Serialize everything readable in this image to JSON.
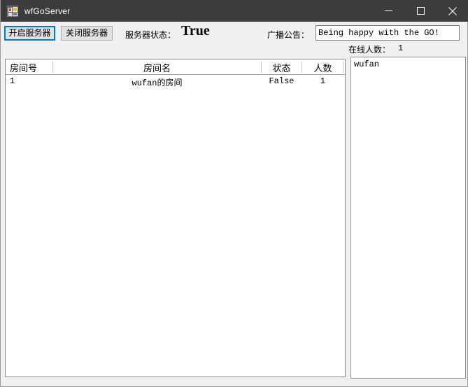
{
  "window": {
    "title": "wfGoServer",
    "icon": "app-icon",
    "controls": {
      "minimize": "minimize-icon",
      "maximize": "maximize-icon",
      "close": "close-icon"
    }
  },
  "toolbar": {
    "start_server_label": "开启服务器",
    "stop_server_label": "关闭服务器",
    "server_status_label": "服务器状态：",
    "server_status_value": "True",
    "broadcast_label": "广播公告：",
    "broadcast_value": "Being happy with the GO!",
    "broadcast_placeholder": "",
    "online_count_label": "在线人数：",
    "online_count_value": "1"
  },
  "rooms_grid": {
    "columns": [
      "房间号",
      "房间名",
      "状态",
      "人数"
    ],
    "rows": [
      {
        "room_id": "1",
        "room_name": "wufan的房间",
        "state": "False",
        "people": "1"
      }
    ]
  },
  "online_list": {
    "items": [
      "wufan"
    ]
  },
  "colors": {
    "titlebar": "#3c3c3c",
    "form_background": "#f0f0f0",
    "accent_focus": "#0078d7",
    "button_face": "#e1e1e1",
    "border": "#8c8c8c"
  }
}
